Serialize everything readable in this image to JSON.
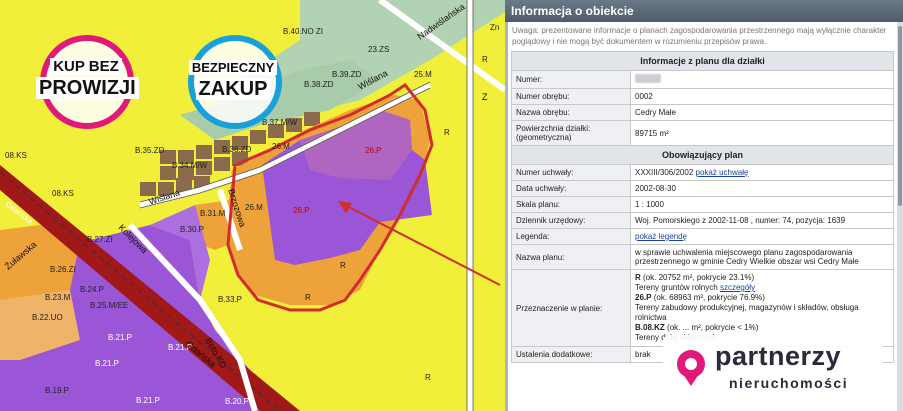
{
  "map": {
    "badges": {
      "no_commission": [
        "KUP BEZ",
        "PROWIZJI"
      ],
      "safe_purchase": [
        "BEZPIECZNY",
        "ZAKUP"
      ]
    },
    "labels": {
      "b40": "B.40.NO ZI",
      "zs23": "23.ZS",
      "b39": "B.39.ZD",
      "b38": "B.38.ZD",
      "m25": "25.M",
      "b36": "B.36.ZD",
      "b37": "B.37.M/W",
      "b34": "B.34.M/W",
      "b35": "B.35.ZD",
      "b33p": "B.33.P",
      "b31": "B.31.M",
      "b30": "B.30.P",
      "b27": "B.27.ZI",
      "b26": "B.26.ZI",
      "b25": "B.25.M/EE",
      "b24": "B.24.P",
      "b23": "B.23.M",
      "b22": "B.22.UO",
      "b21a": "B.21.P",
      "b21b": "B.21.P",
      "b21c": "B.21.P",
      "b21d": "B.21.P",
      "b20": "B.20.P",
      "b19": "B.19.P",
      "ks8": "08.KS",
      "ks8b": "08.KS",
      "zn": "Zn",
      "r1": "R",
      "r2": "R",
      "r3": "R",
      "r4": "R",
      "r5": "R",
      "p26a": "26.P",
      "p26b": "26.P",
      "m26a": "26.M",
      "m26b": "26.M",
      "zd": "B.36.ZD"
    },
    "streets": {
      "wislana1": "Wiślana",
      "wislana2": "Wiślana",
      "nadwisl": "Nadwiślańska",
      "gdanska1": "Gdańska",
      "gdanska2": "Gdańska",
      "brzoz": "Brzozowa",
      "kolowa": "Kolejowa",
      "lawska": "Żuławska",
      "boto": "Boto KD",
      "z": "Z"
    },
    "colors": {
      "yellow": "#f1ef3a",
      "purple": "#9a56d6",
      "orange": "#eea33a",
      "brown": "#8c6a4c",
      "green": "#b2d3b3",
      "red": "#d22c2c",
      "railway": "#a01818"
    }
  },
  "panel": {
    "title": "Informacja o obiekcie",
    "notice": "Uwaga: prezentowane informacje o planach zagospodarowania przestrzennego mają wyłącznie charakter poglądowy i nie mogą być dokumentem w rozumieniu przepisów prawa.",
    "section1": "Informacje z planu dla działki",
    "rows1": [
      {
        "key": "Numer:",
        "value": ""
      },
      {
        "key": "Numer obrębu:",
        "value": "0002"
      },
      {
        "key": "Nazwa obrębu:",
        "value": "Cedry Małe"
      },
      {
        "key": "Powierzchnia działki: (geometryczna)",
        "value": "89715 m²"
      }
    ],
    "section2": "Obowiązujący plan",
    "resolution_key": "Numer uchwały:",
    "resolution_value": "XXXIII/306/2002",
    "resolution_link": "pokaż uchwałę",
    "date_key": "Data uchwały:",
    "date_value": "2002-08-30",
    "scale_key": "Skala planu:",
    "scale_value": "1 : 1000",
    "journal_key": "Dziennik urzędowy:",
    "journal_value": "Woj. Pomorskiego z 2002-11-08 , numer: 74, pozycja: 1639",
    "legend_key": "Legenda:",
    "legend_link": "pokaż legendę",
    "plan_key": "Nazwa planu:",
    "plan_value": "w sprawie uchwalenia miejscowego planu zagospodarowania przestrzennego w gminie Cedry Wielkie obszar wsi Cedry Małe",
    "purpose_key": "Przeznaczenie w planie:",
    "purpose": {
      "r_code": "R",
      "r_area": "(ok. 20752 m², pokrycie 23.1%)",
      "r_desc": "Tereny gruntów rolnych",
      "r_link": "szczegóły",
      "p_code": "26.P",
      "p_area": "(ok. 68963 m², pokrycie 76.9%)",
      "p_desc1": "Tereny zabudowy produkcyjnej, magazynów i składów, obsługa",
      "p_desc2": "rolnictwa",
      "kz_code": "B.08.KZ",
      "kz_area": "(ok. ... m², pokrycie < 1%)",
      "kz_desc": "Tereny dróg zbiorczych"
    },
    "extra_key": "Ustalenia dodatkowe:",
    "extra_value": "brak"
  },
  "logo": {
    "line1": "partnerzy",
    "line2": "nieruchomości",
    "color_main": "#2a2a3a",
    "color_accent": "#e0197a"
  }
}
